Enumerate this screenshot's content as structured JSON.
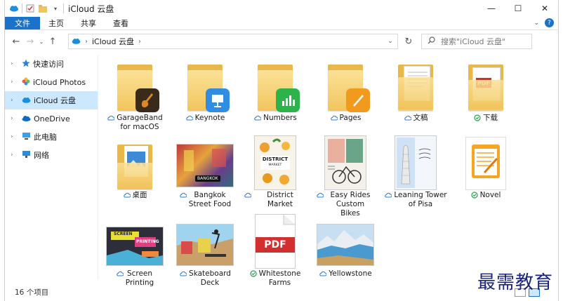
{
  "window": {
    "title": "iCloud 云盘"
  },
  "ribbon": {
    "tabs": [
      "文件",
      "主页",
      "共享",
      "查看"
    ]
  },
  "address": {
    "location": "iCloud 云盘"
  },
  "search": {
    "placeholder": "搜索\"iCloud 云盘\""
  },
  "sidebar": {
    "items": [
      {
        "label": "快速访问",
        "icon": "star-icon"
      },
      {
        "label": "iCloud Photos",
        "icon": "photos-icon"
      },
      {
        "label": "iCloud 云盘",
        "icon": "icloud-icon",
        "selected": true
      },
      {
        "label": "OneDrive",
        "icon": "onedrive-icon"
      },
      {
        "label": "此电脑",
        "icon": "computer-icon"
      },
      {
        "label": "网络",
        "icon": "network-icon"
      }
    ]
  },
  "items": [
    {
      "name": "GarageBand for macOS",
      "lines": [
        "GarageBand",
        "for macOS"
      ],
      "status": "cloud",
      "kind": "folder-app",
      "badge": "garageband"
    },
    {
      "name": "Keynote",
      "lines": [
        "Keynote"
      ],
      "status": "cloud",
      "kind": "folder-app",
      "badge": "keynote"
    },
    {
      "name": "Numbers",
      "lines": [
        "Numbers"
      ],
      "status": "cloud",
      "kind": "folder-app",
      "badge": "numbers"
    },
    {
      "name": "Pages",
      "lines": [
        "Pages"
      ],
      "status": "cloud",
      "kind": "folder-app",
      "badge": "pages"
    },
    {
      "name": "文稿",
      "lines": [
        "文稿"
      ],
      "status": "cloud",
      "kind": "folder-docs"
    },
    {
      "name": "下载",
      "lines": [
        "下载"
      ],
      "status": "synced",
      "kind": "folder-pdf"
    },
    {
      "name": "桌面",
      "lines": [
        "桌面"
      ],
      "status": "cloud",
      "kind": "folder-desktop"
    },
    {
      "name": "Bangkok Street Food",
      "lines": [
        "Bangkok",
        "Street Food"
      ],
      "status": "cloud",
      "kind": "photo-bangkok"
    },
    {
      "name": "District Market",
      "lines": [
        "District Market"
      ],
      "status": "cloud",
      "kind": "doc-district"
    },
    {
      "name": "Easy Rides Custom Bikes",
      "lines": [
        "Easy Rides",
        "Custom Bikes"
      ],
      "status": "cloud",
      "kind": "doc-bikes"
    },
    {
      "name": "Leaning Tower of Pisa",
      "lines": [
        "Leaning Tower",
        "of Pisa"
      ],
      "status": "cloud",
      "kind": "doc-pisa"
    },
    {
      "name": "Novel",
      "lines": [
        "Novel"
      ],
      "status": "synced",
      "kind": "doc-novel"
    },
    {
      "name": "Screen Printing",
      "lines": [
        "Screen",
        "Printing"
      ],
      "status": "cloud",
      "kind": "photo-screen"
    },
    {
      "name": "Skateboard Deck",
      "lines": [
        "Skateboard",
        "Deck"
      ],
      "status": "cloud",
      "kind": "photo-skate"
    },
    {
      "name": "Whitestone Farms",
      "lines": [
        "Whitestone",
        "Farms"
      ],
      "status": "synced",
      "kind": "pdf-file"
    },
    {
      "name": "Yellowstone",
      "lines": [
        "Yellowstone"
      ],
      "status": "cloud",
      "kind": "photo-yellow"
    }
  ],
  "thumb_text": {
    "bangkok": "BANGKOK",
    "district": "DISTRICT",
    "district_sub": "MARKET",
    "pdf": "PDF",
    "screen1": "SCREEN",
    "screen2": "PRINTING"
  },
  "statusbar": {
    "count": "16 个项目"
  },
  "watermark": "最需教育",
  "colors": {
    "accent": "#1a73c8",
    "selected_bg": "#cce8ff",
    "folder": "#f2c55c",
    "synced": "#2e9e4e"
  }
}
